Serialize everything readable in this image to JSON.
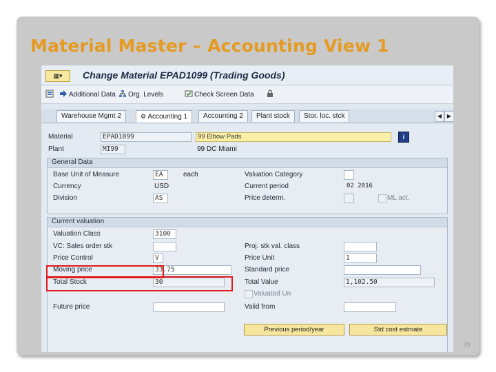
{
  "slide": {
    "title": "Material Master – Accounting View 1",
    "page_number": "39"
  },
  "sap": {
    "window_title": "Change Material EPAD1099 (Trading Goods)",
    "toolbar": {
      "additional_data": "Additional Data",
      "org_levels": "Org. Levels",
      "check_screen_data": "Check Screen Data"
    },
    "tabs": [
      {
        "label": "Warehouse Mgmt 2"
      },
      {
        "label": "Accounting 1"
      },
      {
        "label": "Accounting 2"
      },
      {
        "label": "Plant stock"
      },
      {
        "label": "Stor. loc. stck"
      }
    ],
    "header": {
      "material_label": "Material",
      "material_value": "EPAD1099",
      "material_desc": "99 Elbow Pads",
      "plant_label": "Plant",
      "plant_value": "MI99",
      "plant_desc": "99 DC Miami"
    },
    "general_data": {
      "title": "General Data",
      "base_uom_label": "Base Unit of Measure",
      "base_uom_value": "EA",
      "base_uom_text": "each",
      "currency_label": "Currency",
      "currency_value": "USD",
      "division_label": "Division",
      "division_value": "AS",
      "valuation_category_label": "Valuation Category",
      "current_period_label": "Current period",
      "current_period_value": "02 2016",
      "price_determ_label": "Price determ.",
      "ml_act_label": "ML act."
    },
    "current_valuation": {
      "title": "Current valuation",
      "valuation_class_label": "Valuation Class",
      "valuation_class_value": "3100",
      "vc_sales_order_stk_label": "VC: Sales order stk",
      "proj_stk_val_class_label": "Proj. stk val. class",
      "price_control_label": "Price Control",
      "price_control_value": "V",
      "price_unit_label": "Price Unit",
      "price_unit_value": "1",
      "moving_price_label": "Moving price",
      "moving_price_value": "33.75",
      "standard_price_label": "Standard price",
      "total_stock_label": "Total Stock",
      "total_stock_value": "30",
      "total_value_label": "Total Value",
      "total_value_value": "1,102.50",
      "valuated_un_label": "Valuated Un",
      "future_price_label": "Future price",
      "valid_from_label": "Valid from"
    },
    "buttons": {
      "previous_period": "Previous period/year",
      "std_cost_estimate": "Std cost estmate"
    }
  }
}
